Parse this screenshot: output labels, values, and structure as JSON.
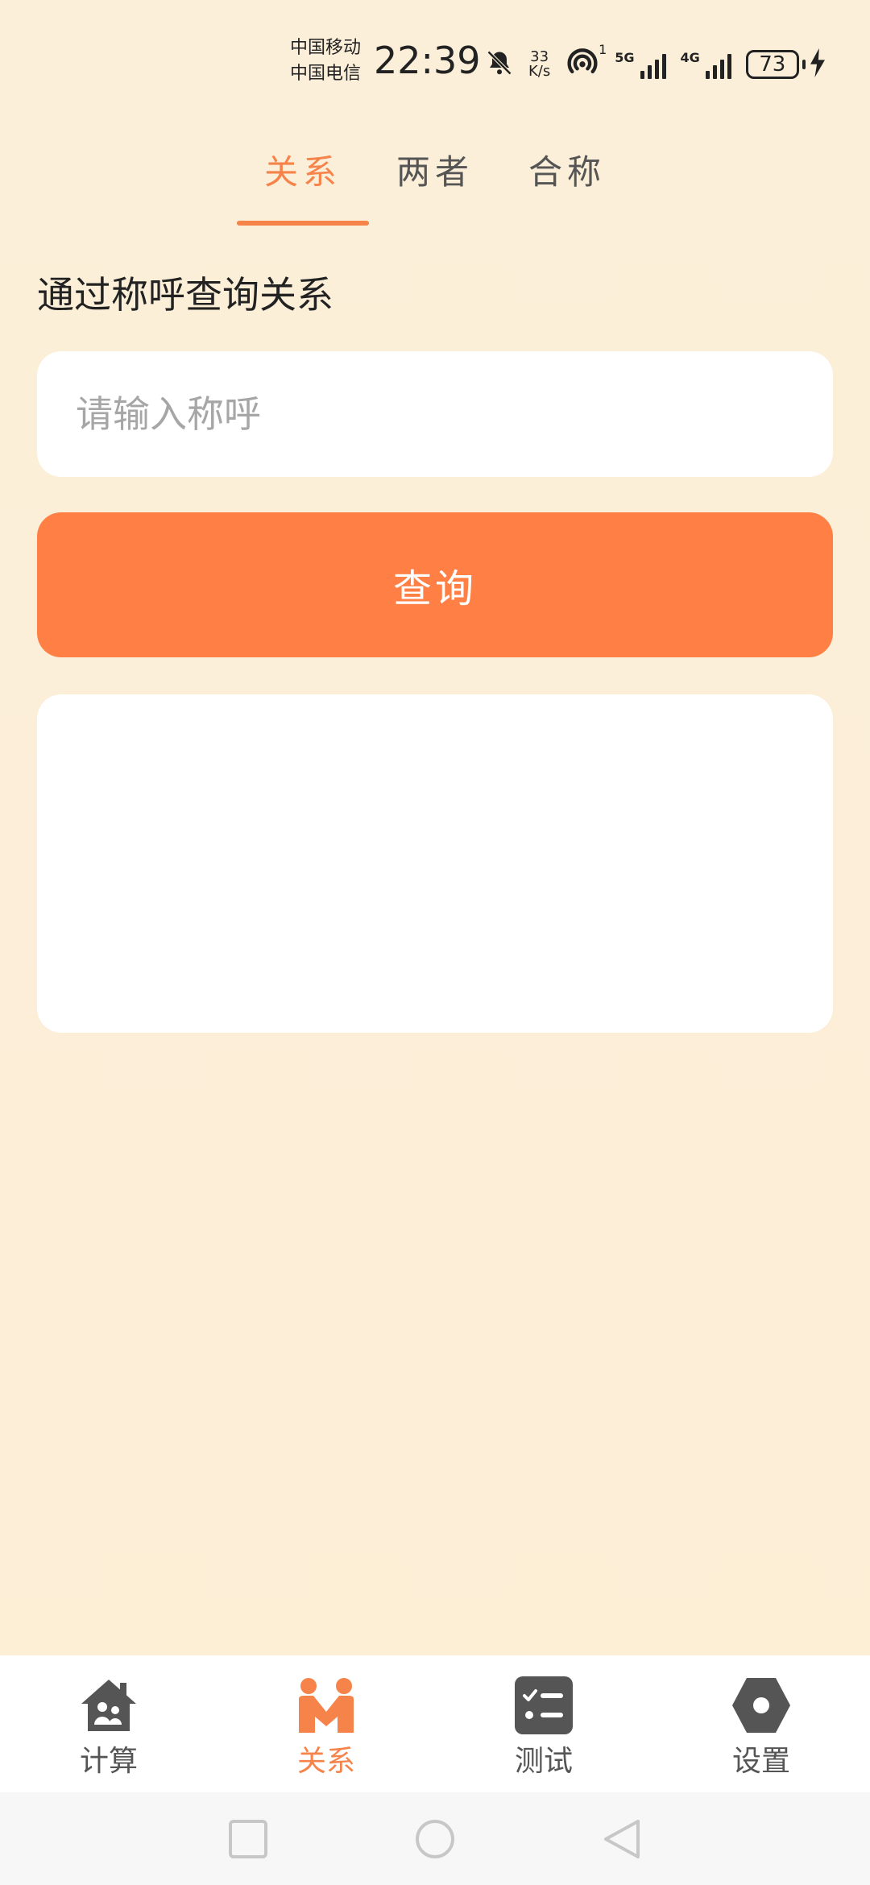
{
  "status_bar": {
    "carrier_1": "中国移动",
    "carrier_2": "中国电信",
    "time": "22:39",
    "net_speed_value": "33",
    "net_speed_unit": "K/s",
    "hotspot_badge": "1",
    "signal_1_label": "5G",
    "signal_2_label": "4G",
    "battery_level": "73"
  },
  "tabs": [
    {
      "label": "关系",
      "active": true
    },
    {
      "label": "两者",
      "active": false
    },
    {
      "label": "合称",
      "active": false
    }
  ],
  "section_title": "通过称呼查询关系",
  "input": {
    "placeholder": "请输入称呼",
    "value": ""
  },
  "query_button_label": "查询",
  "bottom_nav": [
    {
      "label": "计算",
      "icon": "house-family-icon",
      "active": false
    },
    {
      "label": "关系",
      "icon": "handshake-people-icon",
      "active": true
    },
    {
      "label": "测试",
      "icon": "checklist-icon",
      "active": false
    },
    {
      "label": "设置",
      "icon": "hexagon-nut-icon",
      "active": false
    }
  ],
  "colors": {
    "accent": "#f5834a",
    "button": "#ff7f45",
    "background": "#fbefd9",
    "inactive": "#555555"
  }
}
